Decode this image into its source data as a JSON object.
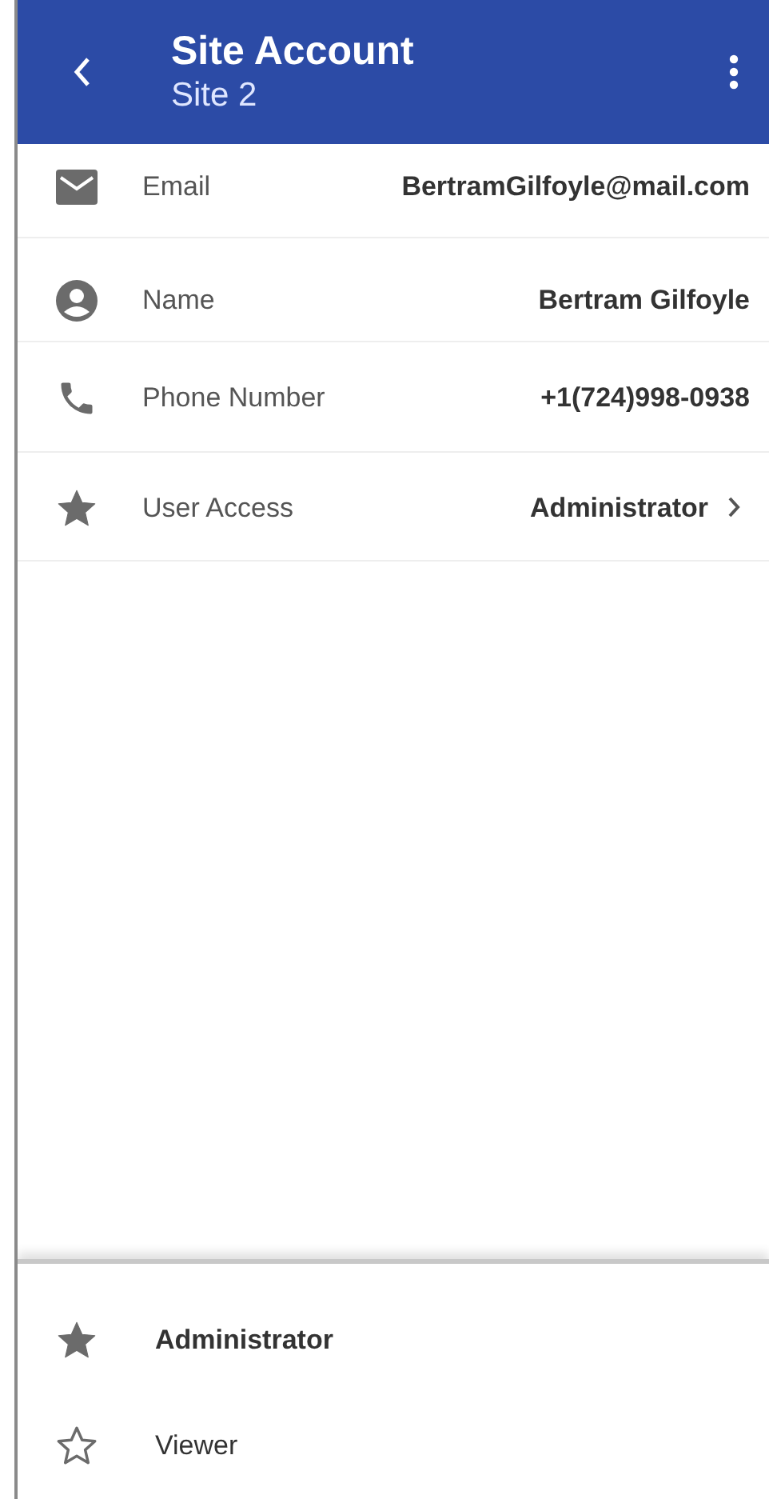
{
  "header": {
    "title": "Site Account",
    "subtitle": "Site 2"
  },
  "fields": [
    {
      "kind": "mail",
      "label": "Email",
      "value": "BertramGilfoyle@mail.com",
      "navigable": false
    },
    {
      "kind": "person",
      "label": "Name",
      "value": "Bertram Gilfoyle",
      "navigable": false
    },
    {
      "kind": "phone",
      "label": "Phone Number",
      "value": "+1(724)998-0938",
      "navigable": false
    },
    {
      "kind": "star",
      "label": "User Access",
      "value": "Administrator",
      "navigable": true
    }
  ],
  "access_options": [
    {
      "label": "Administrator",
      "selected": true
    },
    {
      "label": "Viewer",
      "selected": false
    }
  ]
}
